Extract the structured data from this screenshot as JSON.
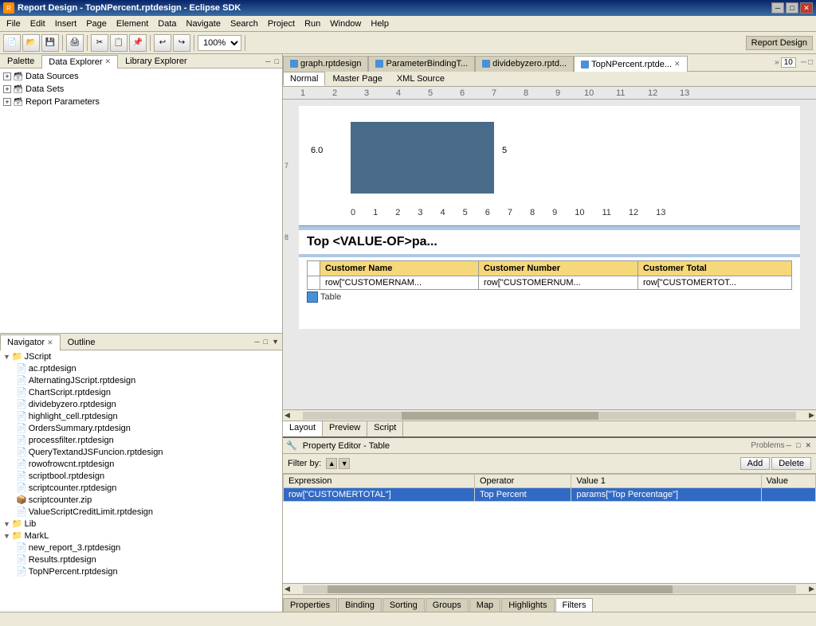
{
  "titleBar": {
    "icon": "R",
    "title": "Report Design - TopNPercent.rptdesign - Eclipse SDK",
    "buttons": [
      "─",
      "□",
      "✕"
    ]
  },
  "menuBar": {
    "items": [
      "File",
      "Edit",
      "Insert",
      "Page",
      "Element",
      "Data",
      "Navigate",
      "Search",
      "Project",
      "Run",
      "Window",
      "Help"
    ]
  },
  "toolbar": {
    "zoomLevel": "100%",
    "rightLabel": "Report Design"
  },
  "leftPanel": {
    "topTabs": [
      {
        "label": "Palette",
        "active": false
      },
      {
        "label": "Data Explorer",
        "active": true,
        "closable": true
      },
      {
        "label": "Library Explorer",
        "active": false
      }
    ],
    "tree": {
      "items": [
        {
          "level": 0,
          "expand": "+",
          "icon": "📁",
          "label": "Data Sources"
        },
        {
          "level": 0,
          "expand": "+",
          "icon": "📁",
          "label": "Data Sets"
        },
        {
          "level": 0,
          "expand": "+",
          "icon": "📁",
          "label": "Report Parameters"
        }
      ]
    },
    "bottomTabs": [
      {
        "label": "Navigator",
        "active": true,
        "closable": true
      },
      {
        "label": "Outline",
        "active": false
      }
    ],
    "navigator": {
      "items": [
        {
          "level": 0,
          "expand": "▼",
          "icon": "📁",
          "label": "JScript"
        },
        {
          "level": 1,
          "icon": "📄",
          "label": "ac.rptdesign"
        },
        {
          "level": 1,
          "icon": "📄",
          "label": "AlternatingJScript.rptdesign"
        },
        {
          "level": 1,
          "icon": "📄",
          "label": "ChartScript.rptdesign"
        },
        {
          "level": 1,
          "icon": "📄",
          "label": "dividebyzero.rptdesign"
        },
        {
          "level": 1,
          "icon": "📄",
          "label": "highlight_cell.rptdesign"
        },
        {
          "level": 1,
          "icon": "📄",
          "label": "OrdersSummary.rptdesign"
        },
        {
          "level": 1,
          "icon": "📄",
          "label": "processfilter.rptdesign"
        },
        {
          "level": 1,
          "icon": "📄",
          "label": "QueryTextandJSFuncion.rptdesign"
        },
        {
          "level": 1,
          "icon": "📄",
          "label": "rowofrowcnt.rptdesign"
        },
        {
          "level": 1,
          "icon": "📄",
          "label": "scriptbool.rptdesign"
        },
        {
          "level": 1,
          "icon": "📄",
          "label": "scriptcounter.rptdesign"
        },
        {
          "level": 1,
          "icon": "📦",
          "label": "scriptcounter.zip"
        },
        {
          "level": 1,
          "icon": "📄",
          "label": "ValueScriptCreditLimit.rptdesign"
        },
        {
          "level": 0,
          "expand": "▼",
          "icon": "📁",
          "label": "Lib"
        },
        {
          "level": 0,
          "expand": "▼",
          "icon": "📁",
          "label": "MarkL"
        },
        {
          "level": 1,
          "icon": "📄",
          "label": "new_report_3.rptdesign"
        },
        {
          "level": 1,
          "icon": "📄",
          "label": "Results.rptdesign"
        },
        {
          "level": 1,
          "icon": "📄",
          "label": "TopNPercent.rptdesign"
        }
      ]
    }
  },
  "editorTabs": [
    {
      "label": "graph.rptdesign",
      "active": false,
      "icon": "blue"
    },
    {
      "label": "ParameterBindingT...",
      "active": false,
      "icon": "blue"
    },
    {
      "label": "dividebyzero.rptd...",
      "active": false,
      "icon": "blue"
    },
    {
      "label": "TopNPercent.rptde...",
      "active": true,
      "icon": "blue",
      "closable": true
    }
  ],
  "designArea": {
    "layoutTabs": [
      {
        "label": "Normal",
        "active": true
      },
      {
        "label": "Master Page",
        "active": false
      },
      {
        "label": "XML Source",
        "active": false
      }
    ],
    "ruler": {
      "marks": [
        "1",
        "2",
        "3",
        "4",
        "5",
        "6",
        "7",
        "8",
        "9",
        "10",
        "11",
        "12",
        "13"
      ]
    },
    "chart": {
      "yLabel": "6.0",
      "rightLabel": "5",
      "xLabels": [
        "0",
        "1",
        "2",
        "3",
        "4",
        "5",
        "6",
        "7",
        "8",
        "9",
        "10",
        "11",
        "12",
        "13"
      ]
    },
    "reportTitle": "Top <VALUE-OF>pa...",
    "tableHeaders": [
      "Customer Name",
      "Customer Number",
      "Customer Total"
    ],
    "tableRow": [
      "row[\"CUSTOMERNAM...",
      "row[\"CUSTOMERNUM...",
      "row[\"CUSTOMERTOT..."
    ],
    "tableLabel": "Table",
    "bottomTabs": [
      {
        "label": "Layout",
        "active": true
      },
      {
        "label": "Preview",
        "active": false
      },
      {
        "label": "Script",
        "active": false
      }
    ]
  },
  "propertyEditor": {
    "title": "Property Editor - Table",
    "filterLabel": "Filter by:",
    "buttons": {
      "add": "Add",
      "delete": "Delete"
    },
    "tableHeaders": [
      "Expression",
      "Operator",
      "Value 1",
      "Value"
    ],
    "tableRows": [
      {
        "expression": "row[\"CUSTOMERTOTAL\"]",
        "operator": "Top Percent",
        "value1": "params[\"Top Percentage\"]",
        "value2": ""
      }
    ],
    "bottomTabs": [
      {
        "label": "Properties",
        "active": false
      },
      {
        "label": "Binding",
        "active": false
      },
      {
        "label": "Sorting",
        "active": false
      },
      {
        "label": "Groups",
        "active": false
      },
      {
        "label": "Map",
        "active": false
      },
      {
        "label": "Highlights",
        "active": false
      },
      {
        "label": "Filters",
        "active": true
      }
    ]
  }
}
